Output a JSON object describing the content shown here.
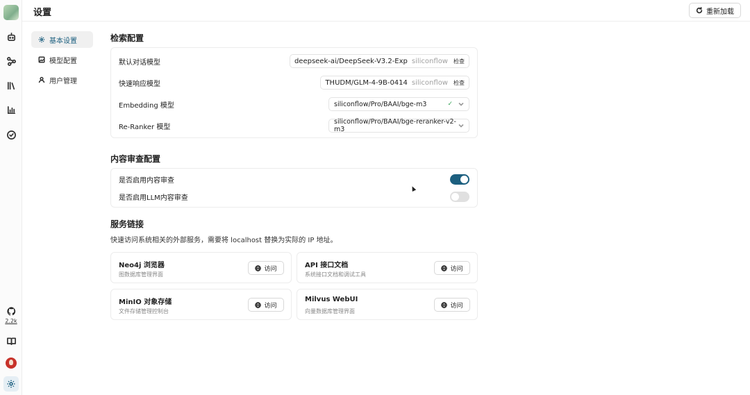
{
  "header": {
    "title": "设置",
    "reload_label": "重新加载"
  },
  "rail": {
    "github_count": "2.2k"
  },
  "subnav": {
    "items": [
      {
        "label": "基本设置",
        "icon": "gear-icon",
        "active": true
      },
      {
        "label": "模型配置",
        "icon": "image-icon",
        "active": false
      },
      {
        "label": "用户管理",
        "icon": "user-icon",
        "active": false
      }
    ]
  },
  "retrieval": {
    "title": "检索配置",
    "default_model": {
      "label": "默认对话模型",
      "value": "deepseek-ai/DeepSeek-V3.2-Exp",
      "provider": "siliconflow",
      "check_label": "检查"
    },
    "fast_model": {
      "label": "快速响应模型",
      "value": "THUDM/GLM-4-9B-0414",
      "provider": "siliconflow",
      "check_label": "检查"
    },
    "embedding": {
      "label": "Embedding 模型",
      "value": "siliconflow/Pro/BAAI/bge-m3",
      "status": "✓"
    },
    "reranker": {
      "label": "Re-Ranker 模型",
      "value": "siliconflow/Pro/BAAI/bge-reranker-v2-m3"
    }
  },
  "moderation": {
    "title": "内容审查配置",
    "enable_moderation": {
      "label": "是否启用内容审查",
      "on": true
    },
    "enable_llm_moderation": {
      "label": "是否启用LLM内容审查",
      "on": false
    }
  },
  "services": {
    "title": "服务链接",
    "description": "快速访问系统相关的外部服务，需要将 localhost 替换为实际的 IP 地址。",
    "visit_label": "访问",
    "items": [
      {
        "name": "Neo4j 浏览器",
        "sub": "图数据库管理界面"
      },
      {
        "name": "API 接口文档",
        "sub": "系统接口文档和调试工具"
      },
      {
        "name": "MinIO 对象存储",
        "sub": "文件存储管理控制台"
      },
      {
        "name": "Milvus WebUI",
        "sub": "向量数据库管理界面"
      }
    ]
  },
  "colors": {
    "accent": "#1c5f7f",
    "toggle_off": "#e0e0e0",
    "ok": "#3aa45a"
  }
}
